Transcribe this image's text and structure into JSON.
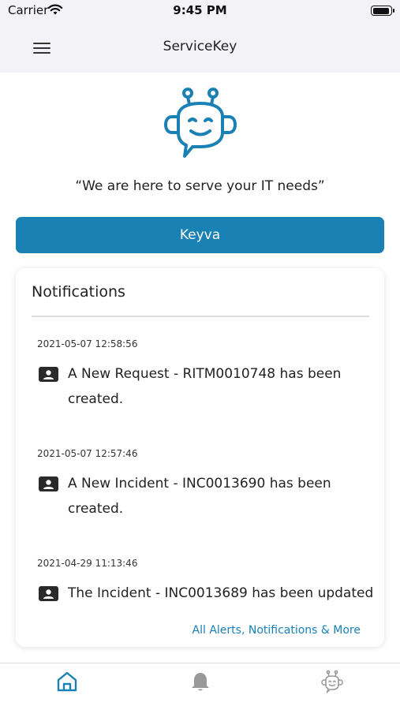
{
  "status_bar": {
    "carrier": "Carrier",
    "time": "9:45 PM"
  },
  "header": {
    "title": "ServiceKey",
    "menu_icon": "hamburger-menu-icon"
  },
  "hero": {
    "logo_icon": "robot-chat-icon",
    "tagline": "“We are here to serve your IT needs”"
  },
  "primary_button": {
    "label": "Keyva"
  },
  "notifications": {
    "title": "Notifications",
    "items": [
      {
        "timestamp": "2021-05-07 12:58:56",
        "icon": "id-card-icon",
        "message": "A New Request - RITM0010748 has been created."
      },
      {
        "timestamp": "2021-05-07 12:57:46",
        "icon": "id-card-icon",
        "message": "A New Incident - INC0013690 has been created."
      },
      {
        "timestamp": "2021-04-29 11:13:46",
        "icon": "id-card-icon",
        "message": "The Incident - INC0013689 has been updated"
      }
    ],
    "more_link": "All Alerts, Notifications & More"
  },
  "tab_bar": {
    "tabs": [
      {
        "name": "home",
        "icon": "home-icon",
        "active": true
      },
      {
        "name": "alerts",
        "icon": "bell-icon",
        "active": false
      },
      {
        "name": "bot",
        "icon": "robot-icon",
        "active": false
      }
    ]
  },
  "colors": {
    "accent": "#1a81b5",
    "inactive_icon": "#999999",
    "header_bg": "#f2f2f7"
  }
}
